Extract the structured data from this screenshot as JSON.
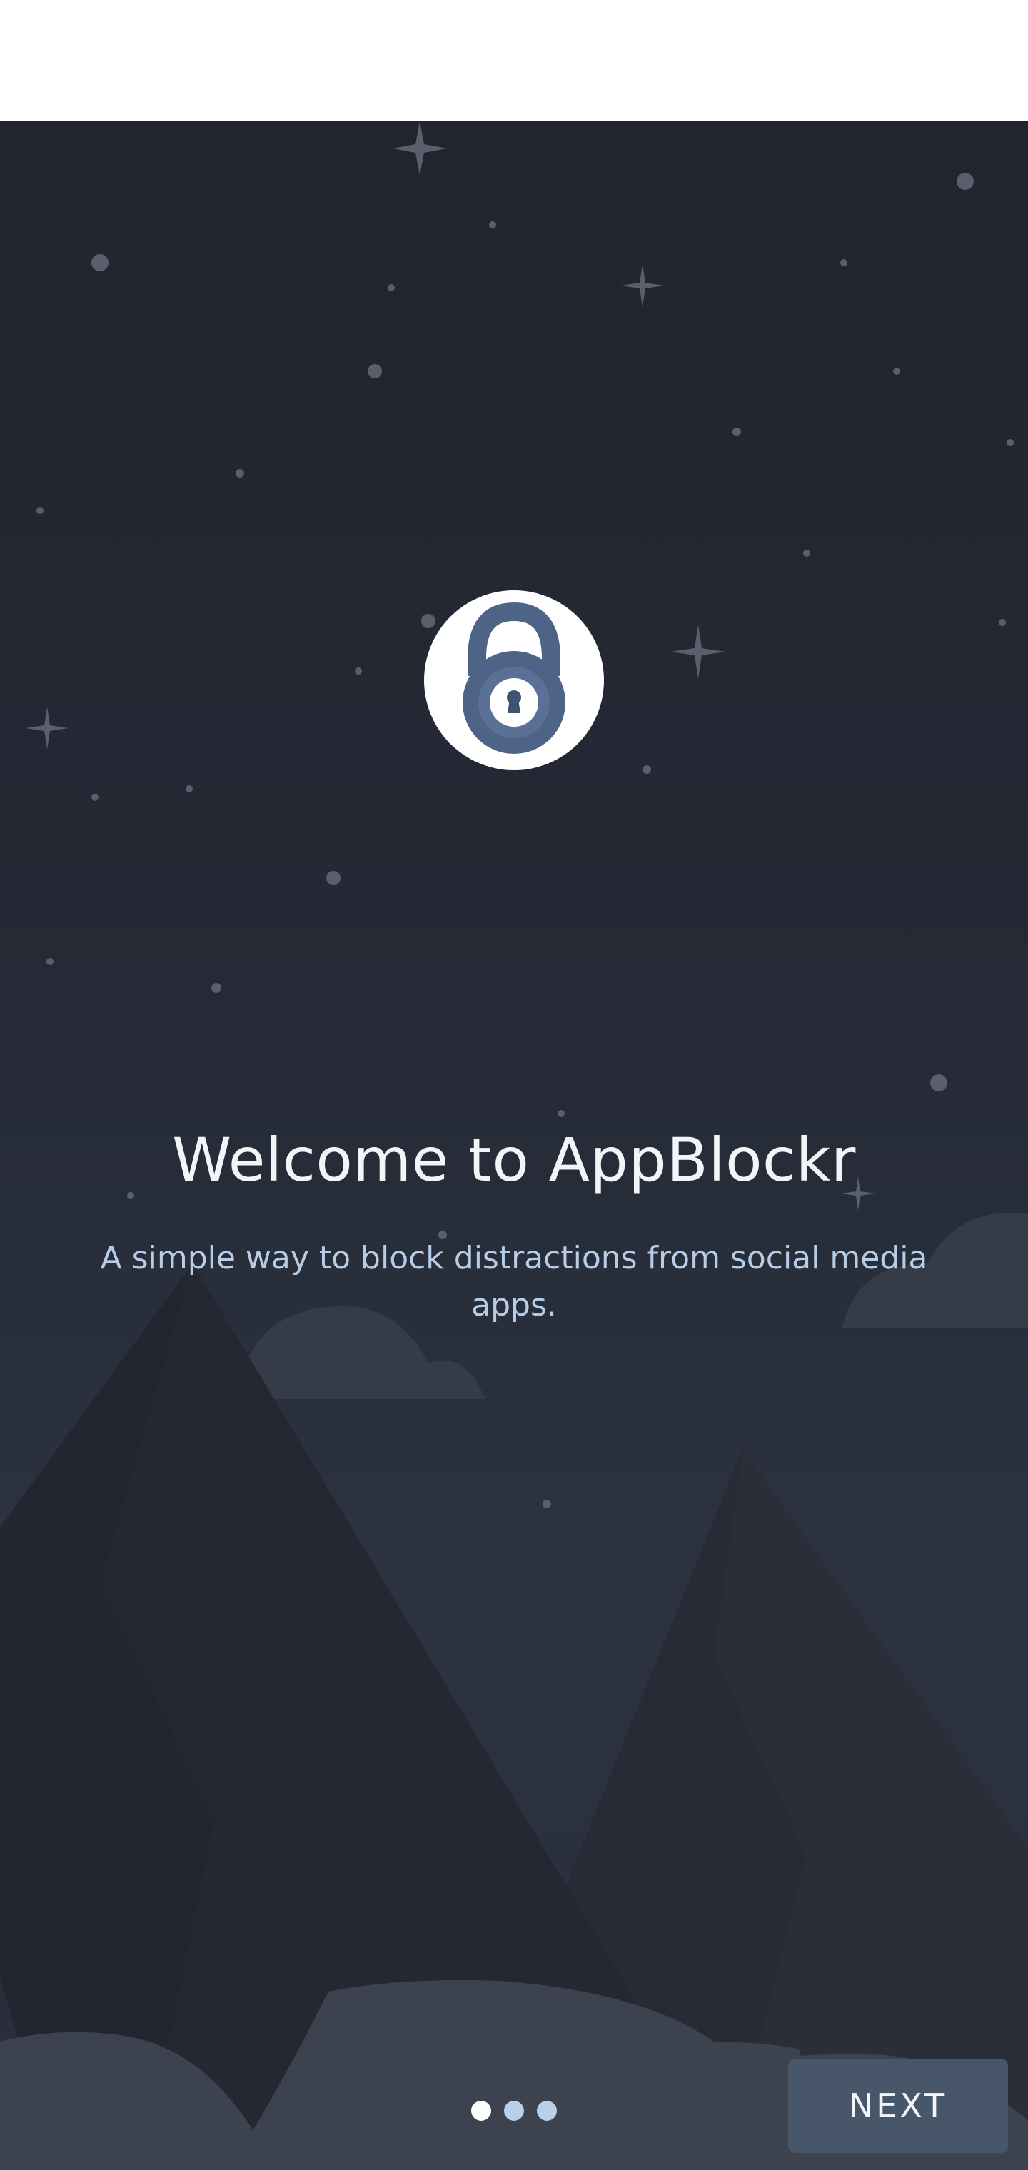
{
  "status_bar": {},
  "onboarding": {
    "logo_icon": "padlock-icon",
    "title": "Welcome to AppBlockr",
    "subtitle": "A simple way to block distractions from social media apps.",
    "page_indicator": {
      "total_pages": 3,
      "current_page": 1,
      "active_color": "#ffffff",
      "inactive_color": "#b8d0ea"
    },
    "next_label": "NEXT"
  },
  "colors": {
    "background_dark": "#22252f",
    "button": "#48566a",
    "subtitle_text": "#b7cce6",
    "lock": "#4d6486"
  }
}
